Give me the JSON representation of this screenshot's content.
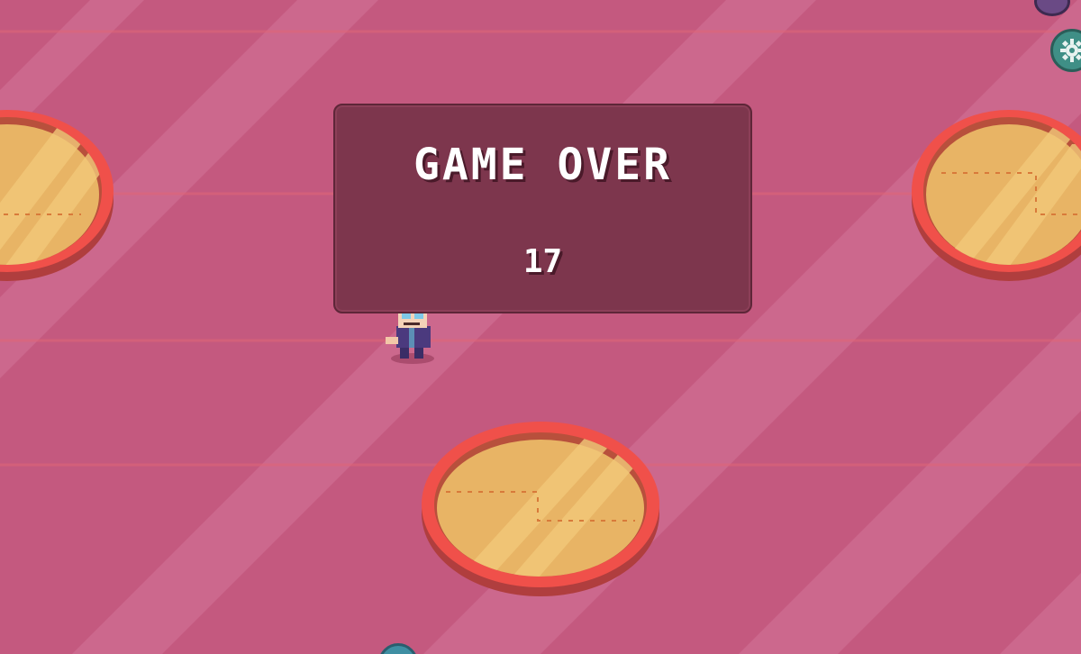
{
  "game_over": {
    "title": "GAME OVER",
    "score": "17"
  },
  "icons": {
    "top_button": "round-button-icon",
    "settings_button": "gear-icon",
    "bottom_button": "round-button-icon",
    "player": "player-character-icon"
  },
  "colors": {
    "background": "#c4597f",
    "stripe": "#cf6e92",
    "line": "#e56a7f",
    "panel": "#7d364d",
    "platform_ring": "#f0504a",
    "platform_fill": "#e8b465"
  }
}
